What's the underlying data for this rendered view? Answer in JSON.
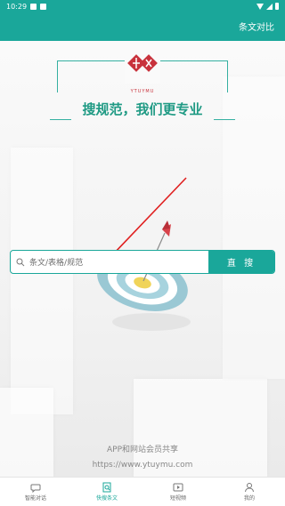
{
  "status_bar": {
    "time": "10:29"
  },
  "app_bar": {
    "action_label": "条文对比"
  },
  "logo": {
    "brand_text": "YTUYMU",
    "slogan": "搜规范，我们更专业"
  },
  "search": {
    "placeholder": "条文/表格/规范",
    "button_label": "直 搜"
  },
  "footer": {
    "line1": "APP和网站会员共享",
    "line2": "https://www.ytuymu.com"
  },
  "nav": {
    "items": [
      {
        "label": "智能对话",
        "icon": "chat-icon",
        "active": false
      },
      {
        "label": "快搜条文",
        "icon": "document-search-icon",
        "active": true
      },
      {
        "label": "短视频",
        "icon": "video-icon",
        "active": false
      },
      {
        "label": "我的",
        "icon": "person-icon",
        "active": false
      }
    ]
  },
  "colors": {
    "accent": "#1aa79a",
    "slogan": "#1f9a84",
    "brand_red": "#c8323c",
    "arrow": "#e02020"
  }
}
